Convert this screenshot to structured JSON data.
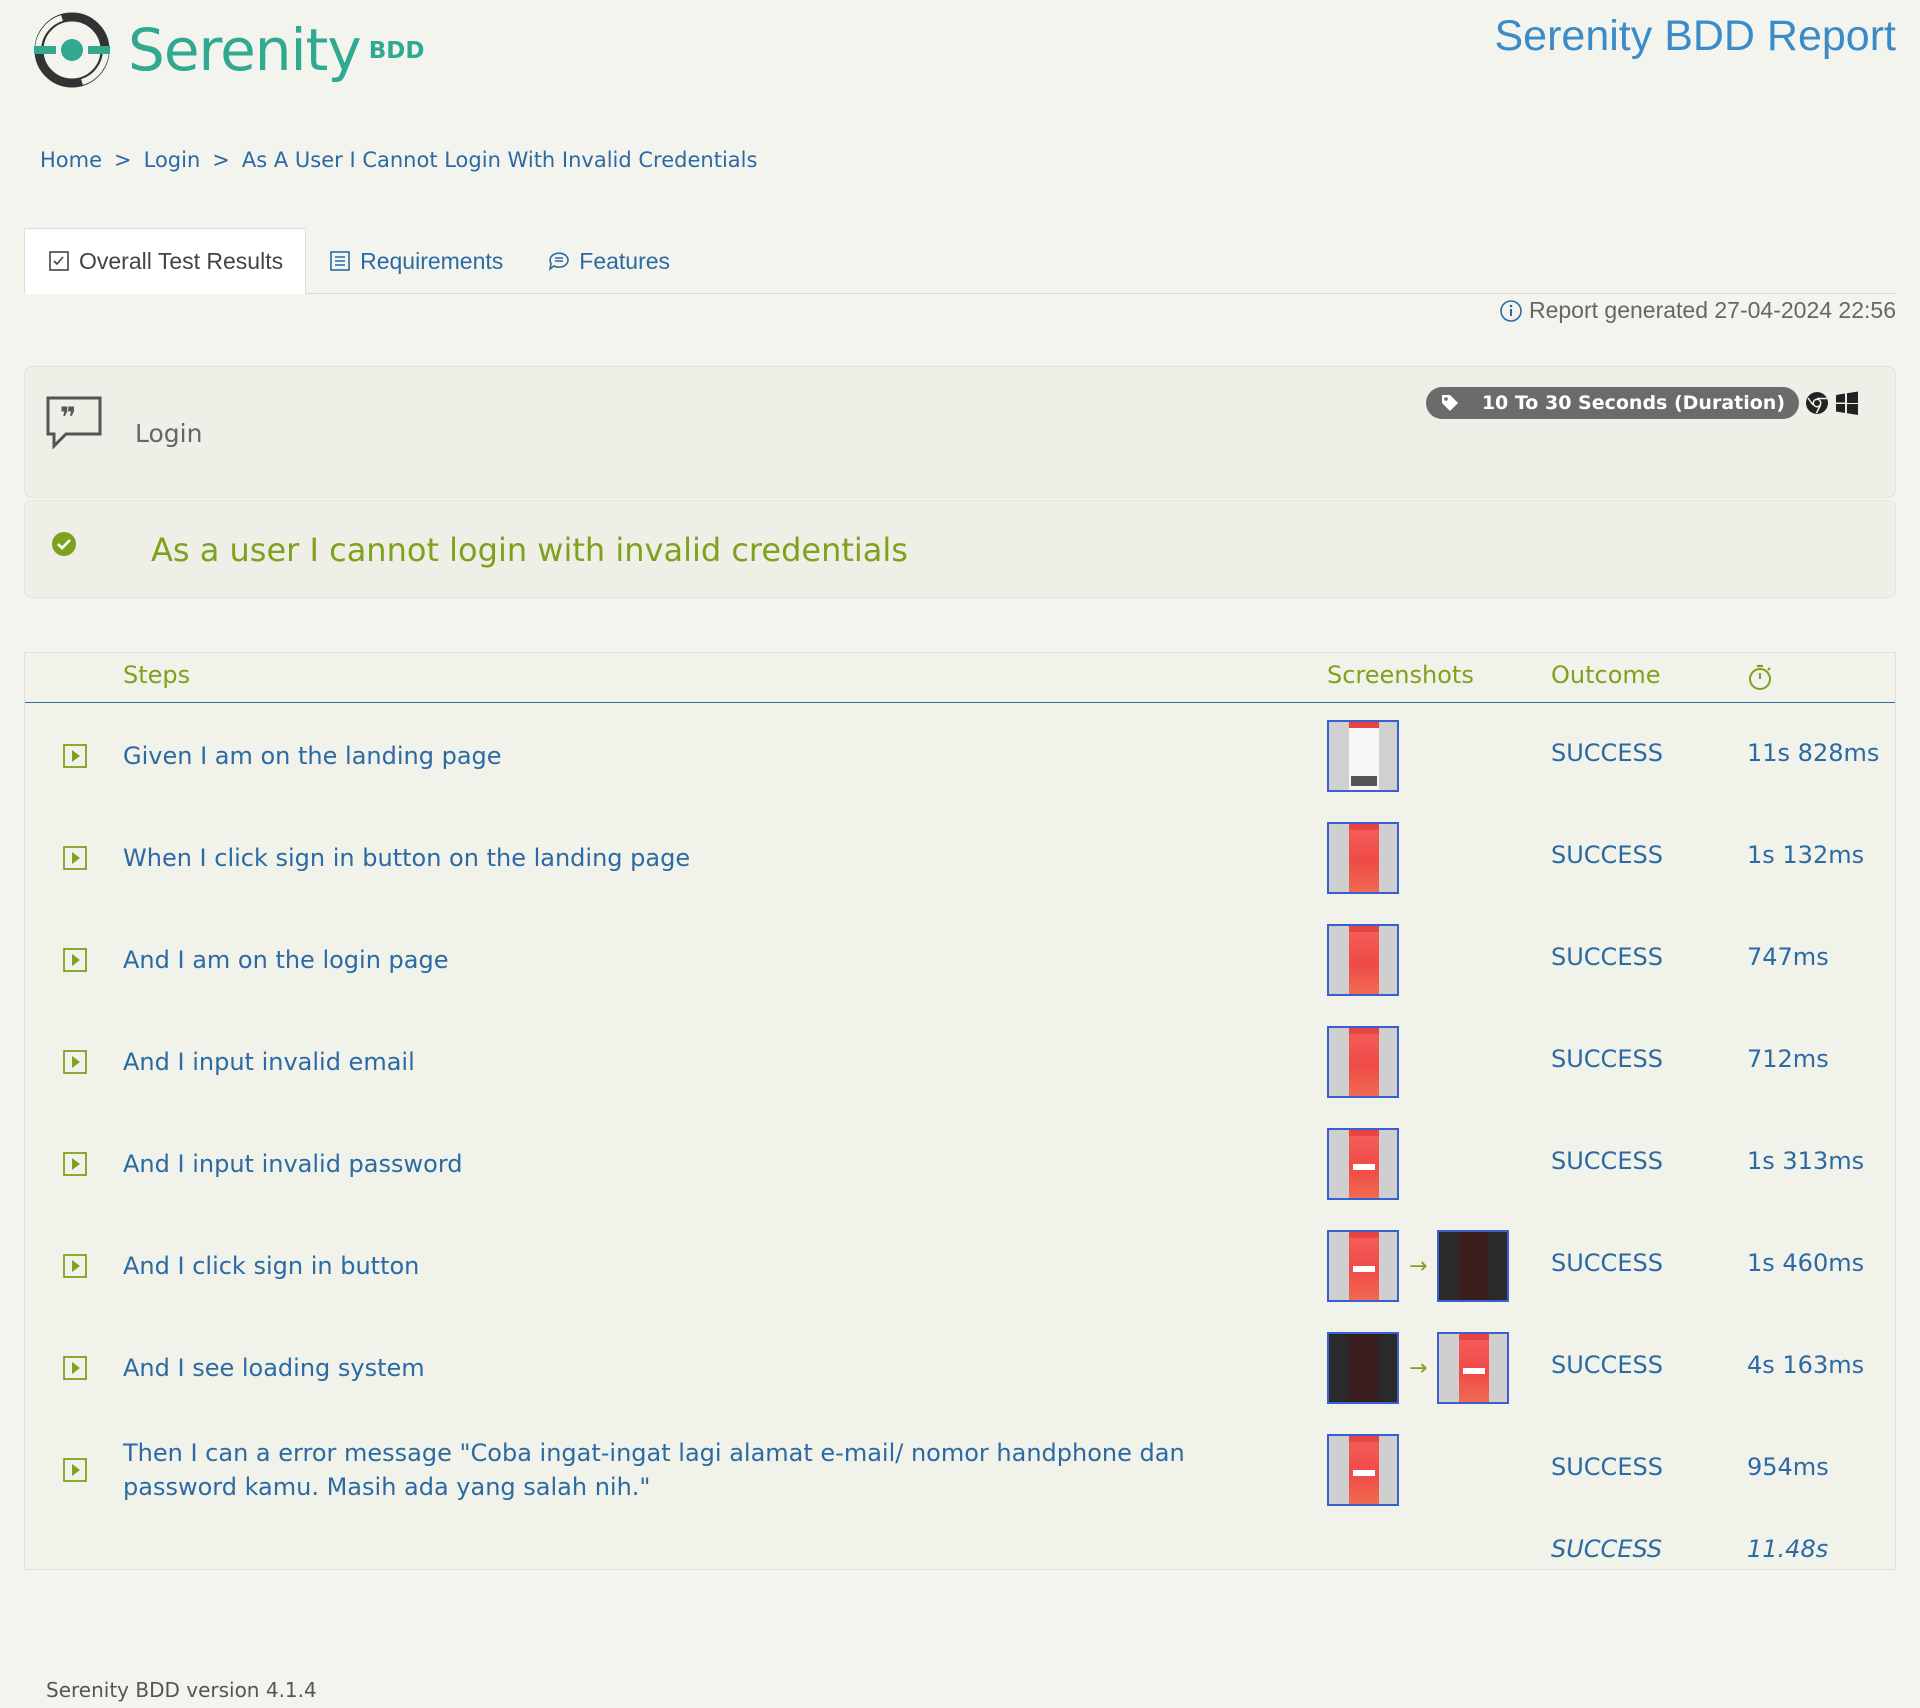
{
  "header": {
    "logo_text": "Serenity",
    "logo_sub": "BDD",
    "report_title": "Serenity BDD Report"
  },
  "breadcrumb": [
    {
      "label": "Home"
    },
    {
      "label": "Login"
    },
    {
      "label": "As A User I Cannot Login With Invalid Credentials"
    }
  ],
  "breadcrumb_separator": ">",
  "tabs": [
    {
      "label": "Overall Test Results",
      "icon": "checklist-icon",
      "active": true
    },
    {
      "label": "Requirements",
      "icon": "list-icon",
      "active": false
    },
    {
      "label": "Features",
      "icon": "comment-icon",
      "active": false
    }
  ],
  "report_generated": "Report generated 27-04-2024 22:56",
  "feature": {
    "name": "Login",
    "icon": "quote-icon",
    "tag": "10 To 30 Seconds (Duration)",
    "platform_icons": [
      "chrome-icon",
      "windows-icon"
    ]
  },
  "scenario": {
    "title": "As a user I cannot login with invalid credentials",
    "status_icon": "check-circle-icon",
    "status_color": "#7ea21e"
  },
  "steps_table": {
    "headers": {
      "steps": "Steps",
      "screenshots": "Screenshots",
      "outcome": "Outcome",
      "duration_icon": "stopwatch-icon"
    },
    "rows": [
      {
        "text": "Given I am on the landing page",
        "shots": [
          "landing"
        ],
        "outcome": "SUCCESS",
        "duration": "11s 828ms"
      },
      {
        "text": "When I click sign in button on the landing page",
        "shots": [
          "red"
        ],
        "outcome": "SUCCESS",
        "duration": "1s 132ms"
      },
      {
        "text": "And I am on the login page",
        "shots": [
          "red"
        ],
        "outcome": "SUCCESS",
        "duration": "747ms"
      },
      {
        "text": "And I input invalid email",
        "shots": [
          "red"
        ],
        "outcome": "SUCCESS",
        "duration": "712ms"
      },
      {
        "text": "And I input invalid password",
        "shots": [
          "red-form"
        ],
        "outcome": "SUCCESS",
        "duration": "1s 313ms"
      },
      {
        "text": "And I click sign in button",
        "shots": [
          "red-form",
          "dark"
        ],
        "outcome": "SUCCESS",
        "duration": "1s 460ms"
      },
      {
        "text": "And I see loading system",
        "shots": [
          "dark",
          "red-form"
        ],
        "outcome": "SUCCESS",
        "duration": "4s 163ms"
      },
      {
        "text": "Then I can a error message \"Coba ingat-ingat lagi alamat e-mail/ nomor handphone dan password kamu. Masih ada yang salah nih.\"",
        "shots": [
          "red-form"
        ],
        "outcome": "SUCCESS",
        "duration": "954ms"
      }
    ],
    "total": {
      "outcome": "SUCCESS",
      "duration": "11.48s"
    }
  },
  "footer": "Serenity BDD version 4.1.4",
  "colors": {
    "background": "#f4f4ee",
    "link": "#2b6aa3",
    "accent_green": "#7ea21e",
    "brand_teal": "#30a990"
  }
}
